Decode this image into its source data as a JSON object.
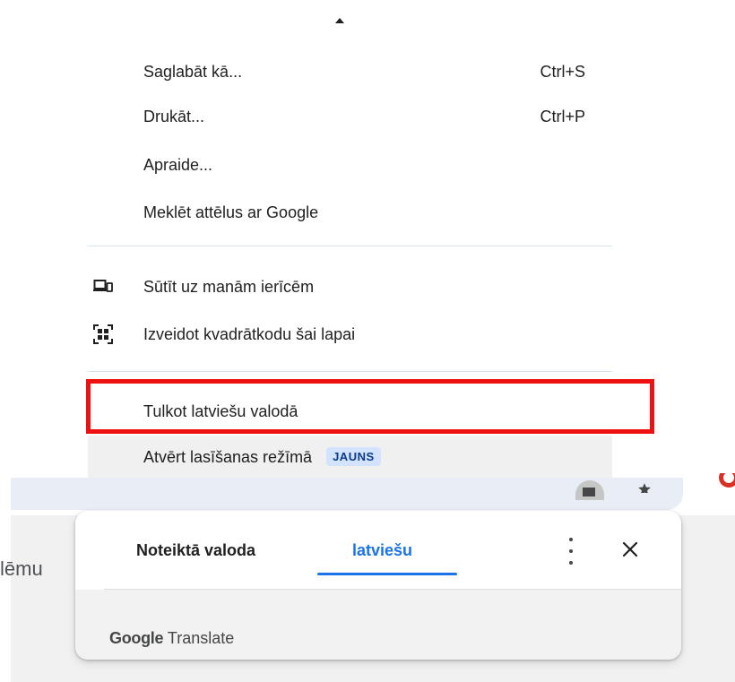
{
  "menu": {
    "items": [
      {
        "label": "Saglabāt kā...",
        "shortcut": "Ctrl+S"
      },
      {
        "label": "Drukāt...",
        "shortcut": "Ctrl+P"
      },
      {
        "label": "Apraide..."
      },
      {
        "label": "Meklēt attēlus ar Google"
      },
      {
        "label": "Sūtīt uz manām ierīcēm",
        "icon": "devices-icon"
      },
      {
        "label": "Izveidot kvadrātkodu šai lapai",
        "icon": "qr-code-icon"
      },
      {
        "label": "Tulkot latviešu valodā"
      },
      {
        "label": "Atvērt lasīšanas režīmā",
        "badge": "JAUNS"
      }
    ]
  },
  "page": {
    "fragment_text": "lēmu"
  },
  "translate_popup": {
    "tabs": [
      {
        "label": "Noteiktā valoda"
      },
      {
        "label": "latviešu",
        "selected": true
      }
    ],
    "brand_google": "Google",
    "brand_translate": "Translate"
  },
  "colors": {
    "highlight": "#ee1111",
    "accent": "#1a73e8",
    "badge_bg": "#d3e3fd"
  }
}
